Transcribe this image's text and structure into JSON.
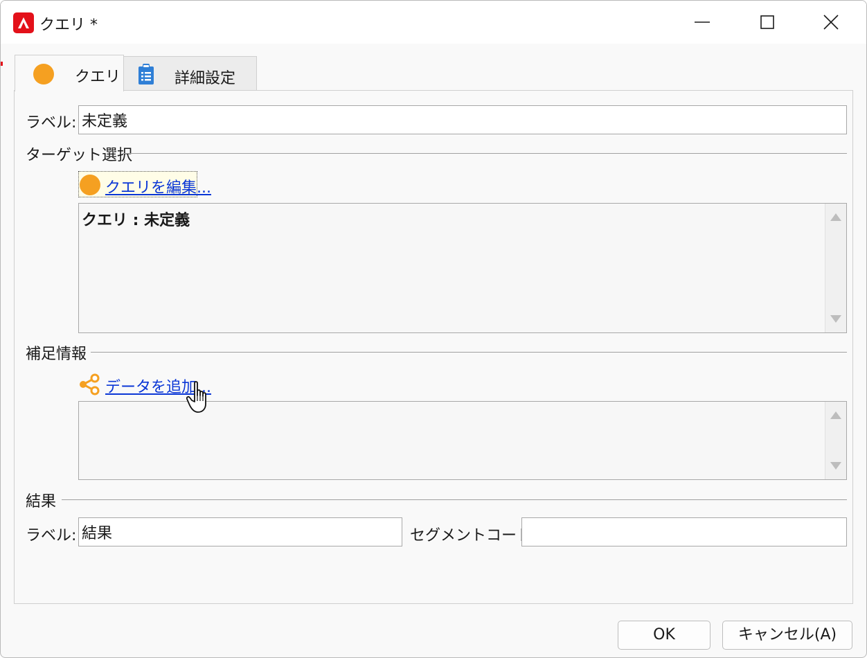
{
  "window": {
    "title": "クエリ *"
  },
  "tabs": [
    {
      "label": "クエリ",
      "icon": "orange-circle-icon",
      "active": true
    },
    {
      "label": "詳細設定",
      "icon": "clipboard-icon",
      "active": false
    }
  ],
  "label_field": {
    "label": "ラベル:",
    "value": "未定義"
  },
  "target_section": {
    "title": "ターゲット選択",
    "edit_link": "クエリを編集...",
    "summary": "クエリ : 未定義"
  },
  "supplement_section": {
    "title": "補足情報",
    "add_link": "データを追加..."
  },
  "result_section": {
    "title": "結果",
    "label": "ラベル:",
    "label_value": "結果",
    "segment_label": "セグメントコード:",
    "segment_value": ""
  },
  "buttons": {
    "ok": "OK",
    "cancel": "キャンセル(A)"
  },
  "colors": {
    "accent_orange": "#f5a021",
    "link_blue": "#0a36d6",
    "brand_red": "#e3111a"
  }
}
